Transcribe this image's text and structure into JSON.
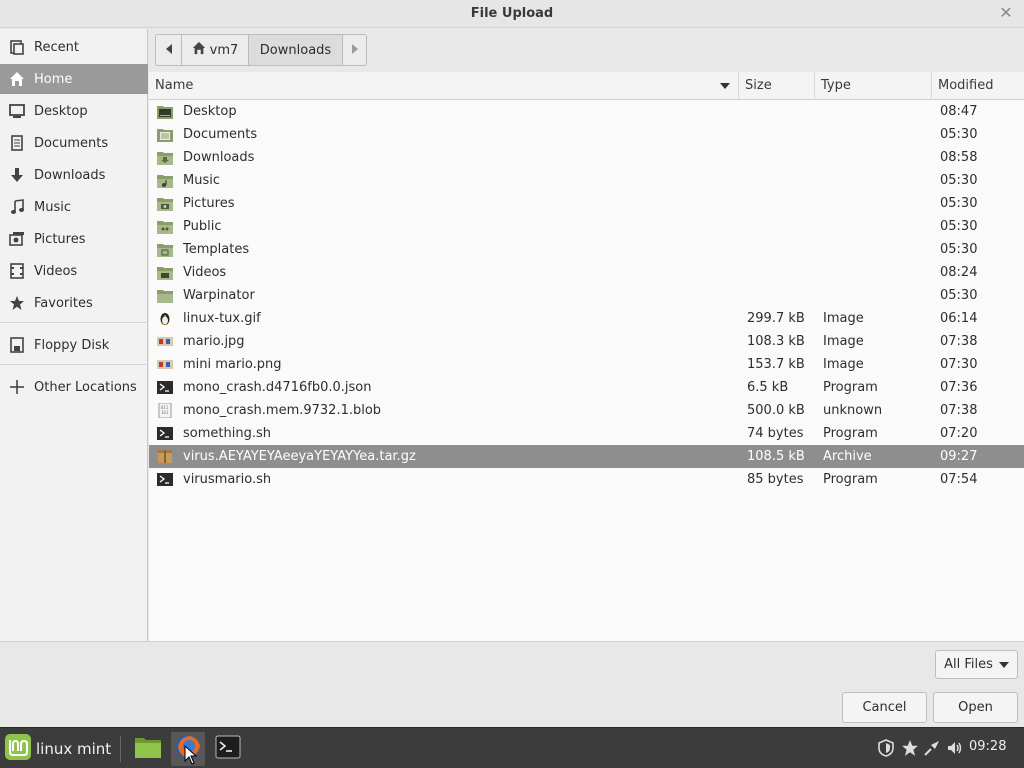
{
  "window": {
    "title": "File Upload"
  },
  "sidebar": {
    "items": [
      {
        "label": "Recent",
        "icon": "recent-icon"
      },
      {
        "label": "Home",
        "icon": "home-icon",
        "active": true
      },
      {
        "label": "Desktop",
        "icon": "desktop-icon"
      },
      {
        "label": "Documents",
        "icon": "documents-icon"
      },
      {
        "label": "Downloads",
        "icon": "downloads-icon"
      },
      {
        "label": "Music",
        "icon": "music-icon"
      },
      {
        "label": "Pictures",
        "icon": "pictures-icon"
      },
      {
        "label": "Videos",
        "icon": "videos-icon"
      },
      {
        "label": "Favorites",
        "icon": "star-icon"
      },
      {
        "label": "Floppy Disk",
        "icon": "floppy-icon"
      },
      {
        "label": "Other Locations",
        "icon": "plus-icon"
      }
    ]
  },
  "pathbar": {
    "segments": [
      {
        "label": "vm7",
        "icon": "home-icon"
      },
      {
        "label": "Downloads"
      }
    ]
  },
  "filelist": {
    "columns": {
      "name": "Name",
      "size": "Size",
      "type": "Type",
      "modified": "Modified"
    },
    "rows": [
      {
        "name": "Desktop",
        "size": "",
        "type": "",
        "modified": "08:47",
        "icon": "folder-desktop-icon"
      },
      {
        "name": "Documents",
        "size": "",
        "type": "",
        "modified": "05:30",
        "icon": "folder-documents-icon"
      },
      {
        "name": "Downloads",
        "size": "",
        "type": "",
        "modified": "08:58",
        "icon": "folder-downloads-icon"
      },
      {
        "name": "Music",
        "size": "",
        "type": "",
        "modified": "05:30",
        "icon": "folder-music-icon"
      },
      {
        "name": "Pictures",
        "size": "",
        "type": "",
        "modified": "05:30",
        "icon": "folder-pictures-icon"
      },
      {
        "name": "Public",
        "size": "",
        "type": "",
        "modified": "05:30",
        "icon": "folder-public-icon"
      },
      {
        "name": "Templates",
        "size": "",
        "type": "",
        "modified": "05:30",
        "icon": "folder-templates-icon"
      },
      {
        "name": "Videos",
        "size": "",
        "type": "",
        "modified": "08:24",
        "icon": "folder-videos-icon"
      },
      {
        "name": "Warpinator",
        "size": "",
        "type": "",
        "modified": "05:30",
        "icon": "folder-icon"
      },
      {
        "name": "linux-tux.gif",
        "size": "299.7 kB",
        "type": "Image",
        "modified": "06:14",
        "icon": "tux-image-icon"
      },
      {
        "name": "mario.jpg",
        "size": "108.3 kB",
        "type": "Image",
        "modified": "07:38",
        "icon": "image-thumbnail-icon"
      },
      {
        "name": "mini mario.png",
        "size": "153.7 kB",
        "type": "Image",
        "modified": "07:30",
        "icon": "image-thumbnail-icon"
      },
      {
        "name": "mono_crash.d4716fb0.0.json",
        "size": "6.5 kB",
        "type": "Program",
        "modified": "07:36",
        "icon": "terminal-file-icon"
      },
      {
        "name": "mono_crash.mem.9732.1.blob",
        "size": "500.0 kB",
        "type": "unknown",
        "modified": "07:38",
        "icon": "binary-file-icon"
      },
      {
        "name": "something.sh",
        "size": "74 bytes",
        "type": "Program",
        "modified": "07:20",
        "icon": "terminal-file-icon"
      },
      {
        "name": "virus.AEYAYEYAeeyaYEYAYYea.tar.gz",
        "size": "108.5 kB",
        "type": "Archive",
        "modified": "09:27",
        "icon": "archive-icon",
        "selected": true
      },
      {
        "name": "virusmario.sh",
        "size": "85 bytes",
        "type": "Program",
        "modified": "07:54",
        "icon": "terminal-file-icon"
      }
    ]
  },
  "footer": {
    "filter_label": "All Files",
    "cancel_label": "Cancel",
    "open_label": "Open"
  },
  "taskbar": {
    "menu_label": "linux mint",
    "apps": [
      {
        "name": "file-manager-icon"
      },
      {
        "name": "firefox-icon",
        "active": true
      },
      {
        "name": "terminal-icon"
      }
    ],
    "tray": [
      "shield-icon",
      "star-icon",
      "network-icon",
      "volume-icon"
    ],
    "clock": "09:28"
  },
  "colors": {
    "selection": "#8e8e8e",
    "taskbar": "#3c3c3c",
    "mint_green": "#8fc34a"
  }
}
